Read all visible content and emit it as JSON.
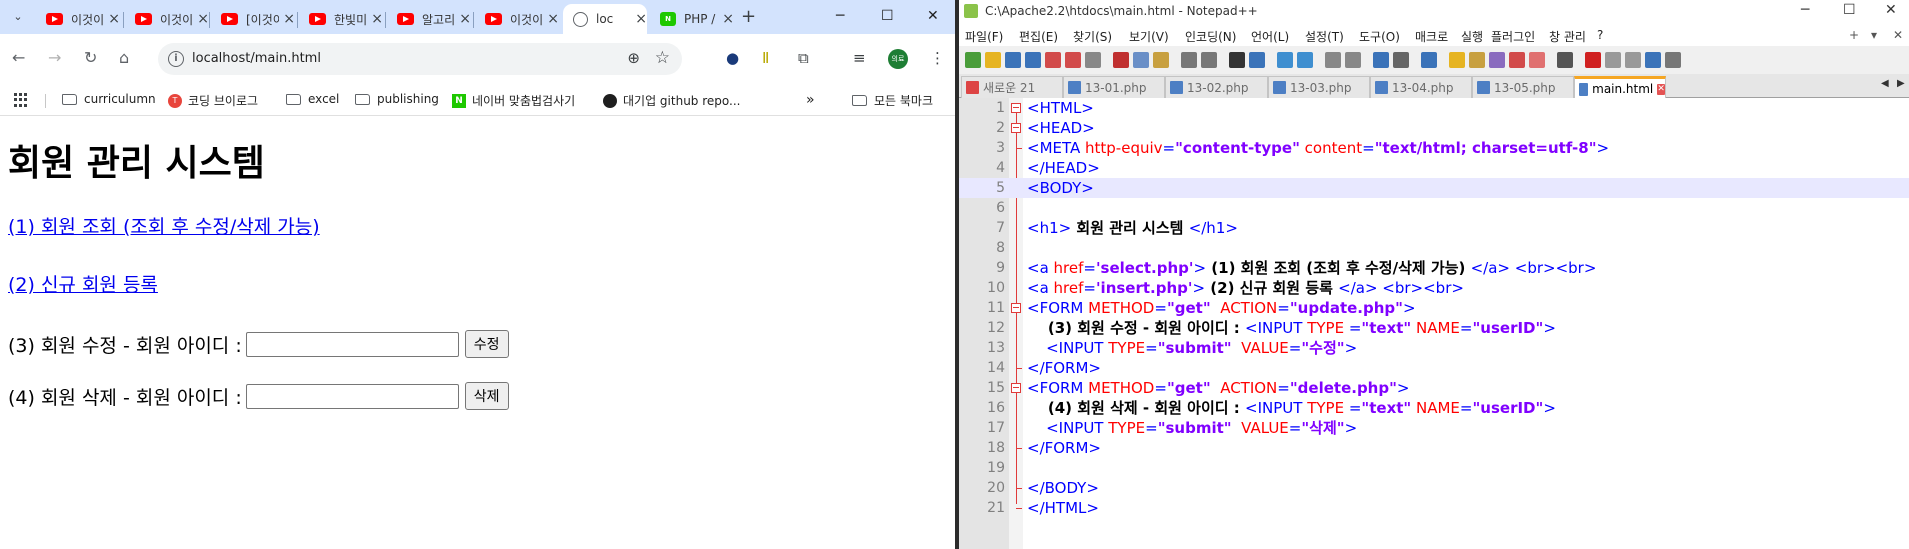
{
  "chrome": {
    "tabs": [
      {
        "label": "이것이",
        "icon": "youtube-icon"
      },
      {
        "label": "이것이",
        "icon": "youtube-icon"
      },
      {
        "label": "[이것이",
        "icon": "youtube-icon"
      },
      {
        "label": "한빛미",
        "icon": "youtube-icon"
      },
      {
        "label": "알고리",
        "icon": "youtube-icon"
      },
      {
        "label": "이것이",
        "icon": "youtube-icon"
      },
      {
        "label": "loc",
        "icon": "globe-icon",
        "active": true
      },
      {
        "label": "PHP / I",
        "icon": "naver-icon"
      }
    ],
    "url": "localhost/main.html",
    "avatar_text": "의료",
    "bookmarks": [
      "curriculumn",
      "코딩 브이로그",
      "excel",
      "publishing",
      "네이버 맞춤법검사기",
      "대기업 github repo...",
      "모든 북마크"
    ],
    "overflow": "»"
  },
  "page": {
    "heading": "회원 관리 시스템",
    "link1": "(1) 회원 조회 (조회 후 수정/삭제 가능)",
    "link2": "(2) 신규 회원 등록",
    "form1_label": "(3) 회원 수정 - 회원 아이디 :",
    "form1_button": "수정",
    "form2_label": "(4) 회원 삭제 - 회원 아이디 :",
    "form2_button": "삭제"
  },
  "npp": {
    "title": "C:\\Apache2.2\\htdocs\\main.html - Notepad++",
    "menu": [
      "파일(F)",
      "편집(E)",
      "찾기(S)",
      "보기(V)",
      "인코딩(N)",
      "언어(L)",
      "설정(T)",
      "도구(O)",
      "매크로",
      "실행",
      "플러그인",
      "창 관리",
      "?"
    ],
    "tabs": [
      {
        "label": "새로운 21"
      },
      {
        "label": "13-01.php"
      },
      {
        "label": "13-02.php"
      },
      {
        "label": "13-03.php"
      },
      {
        "label": "13-04.php"
      },
      {
        "label": "13-05.php"
      },
      {
        "label": "main.html",
        "active": true
      }
    ],
    "line_numbers": [
      "1",
      "2",
      "3",
      "4",
      "5",
      "6",
      "7",
      "8",
      "9",
      "10",
      "11",
      "12",
      "13",
      "14",
      "15",
      "16",
      "17",
      "18",
      "19",
      "20",
      "21"
    ],
    "code": {
      "l1": "<HTML>",
      "l2": "<HEAD>",
      "l3a": "<META ",
      "l3b": "http-equiv",
      "l3c": "=",
      "l3d": "\"content-type\"",
      "l3e": " content",
      "l3f": "=",
      "l3g": "\"text/html; charset=utf-8\"",
      "l3h": ">",
      "l4": "</HEAD>",
      "l5": "<BODY>",
      "l7a": "<h1>",
      "l7b": " 회원 관리 시스템 ",
      "l7c": "</h1>",
      "l9a": "<a ",
      "l9b": "href",
      "l9c": "=",
      "l9d": "'select.php'",
      "l9e": ">",
      "l9f": " (1) 회원 조회 (조회 후 수정/삭제 가능) ",
      "l9g": "</a> <br><br>",
      "l10a": "<a ",
      "l10b": "href",
      "l10c": "=",
      "l10d": "'insert.php'",
      "l10e": ">",
      "l10f": " (2) 신규 회원 등록 ",
      "l10g": "</a> <br><br>",
      "l11a": "<FORM ",
      "l11b": "METHOD",
      "l11c": "=",
      "l11d": "\"get\"",
      "l11e": "  ACTION",
      "l11f": "=",
      "l11g": "\"update.php\"",
      "l11h": ">",
      "l12a": "    (3) 회원 수정 - 회원 아이디 : ",
      "l12b": "<INPUT ",
      "l12c": "TYPE ",
      "l12d": "=",
      "l12e": "\"text\"",
      "l12f": " NAME",
      "l12g": "=",
      "l12h": "\"userID\"",
      "l12i": ">",
      "l13a": "    <INPUT ",
      "l13b": "TYPE",
      "l13c": "=",
      "l13d": "\"submit\"",
      "l13e": "  VALUE",
      "l13f": "=",
      "l13g": "\"수정\"",
      "l13h": ">",
      "l14": "</FORM>",
      "l15a": "<FORM ",
      "l15b": "METHOD",
      "l15c": "=",
      "l15d": "\"get\"",
      "l15e": "  ACTION",
      "l15f": "=",
      "l15g": "\"delete.php\"",
      "l15h": ">",
      "l16a": "    (4) 회원 삭제 - 회원 아이디 : ",
      "l16b": "<INPUT ",
      "l16c": "TYPE ",
      "l16d": "=",
      "l16e": "\"text\"",
      "l16f": " NAME",
      "l16g": "=",
      "l16h": "\"userID\"",
      "l16i": ">",
      "l17a": "    <INPUT ",
      "l17b": "TYPE",
      "l17c": "=",
      "l17d": "\"submit\"",
      "l17e": "  VALUE",
      "l17f": "=",
      "l17g": "\"삭제\"",
      "l17h": ">",
      "l18": "</FORM>",
      "l20": "</BODY>",
      "l21": "</HTML>"
    }
  }
}
